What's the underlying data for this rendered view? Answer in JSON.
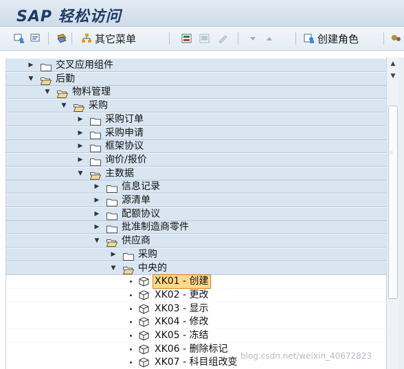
{
  "window": {
    "title": "SAP 轻松访问"
  },
  "toolbar": {
    "other_menu_label": "其它菜单",
    "create_role_label": "创建角色"
  },
  "tree": [
    {
      "label": "交叉应用组件",
      "type": "folder",
      "expanded": false,
      "level": 0
    },
    {
      "label": "后勤",
      "type": "folder",
      "expanded": true,
      "level": 0
    },
    {
      "label": "物料管理",
      "type": "folder",
      "expanded": true,
      "level": 1
    },
    {
      "label": "采购",
      "type": "folder",
      "expanded": true,
      "level": 2
    },
    {
      "label": "采购订单",
      "type": "folder",
      "expanded": false,
      "level": 3
    },
    {
      "label": "采购申请",
      "type": "folder",
      "expanded": false,
      "level": 3
    },
    {
      "label": "框架协议",
      "type": "folder",
      "expanded": false,
      "level": 3
    },
    {
      "label": "询价/报价",
      "type": "folder",
      "expanded": false,
      "level": 3
    },
    {
      "label": "主数据",
      "type": "folder",
      "expanded": true,
      "level": 3
    },
    {
      "label": "信息记录",
      "type": "folder",
      "expanded": false,
      "level": 4
    },
    {
      "label": "源清单",
      "type": "folder",
      "expanded": false,
      "level": 4
    },
    {
      "label": "配额协议",
      "type": "folder",
      "expanded": false,
      "level": 4
    },
    {
      "label": "批准制造商零件",
      "type": "folder",
      "expanded": false,
      "level": 4
    },
    {
      "label": "供应商",
      "type": "folder",
      "expanded": true,
      "level": 4
    },
    {
      "label": "采购",
      "type": "folder",
      "expanded": false,
      "level": 5
    },
    {
      "label": "中央的",
      "type": "folder",
      "expanded": true,
      "level": 5
    },
    {
      "label": "XK01 - 创建",
      "type": "transaction",
      "level": 6,
      "selected": true
    },
    {
      "label": "XK02 - 更改",
      "type": "transaction",
      "level": 6
    },
    {
      "label": "XK03 - 显示",
      "type": "transaction",
      "level": 6
    },
    {
      "label": "XK04 - 修改",
      "type": "transaction",
      "level": 6
    },
    {
      "label": "XK05 - 冻结",
      "type": "transaction",
      "level": 6
    },
    {
      "label": "XK06 - 删除标记",
      "type": "transaction",
      "level": 6
    },
    {
      "label": "XK07 - 科目组改变",
      "type": "transaction",
      "level": 6
    }
  ],
  "watermark": "blog.csdn.net/weixin_40672823",
  "colors": {
    "accent": "#1d3b64",
    "selected_bg": "#ffd98a",
    "selected_border": "#e07a18",
    "row_highlight": "#d9e6f1"
  }
}
